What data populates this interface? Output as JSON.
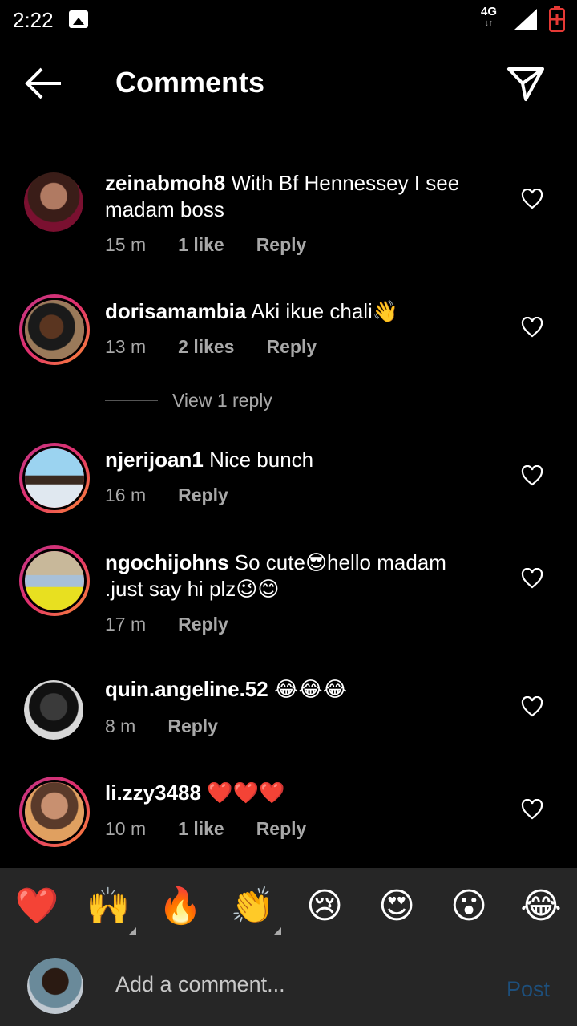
{
  "status_bar": {
    "time": "2:22",
    "network": "4G"
  },
  "header": {
    "title": "Comments"
  },
  "comments": [
    {
      "username": "zeinabmoh8",
      "text": "With Bf Hennessey I see madam boss",
      "time": "15 m",
      "likes": "1 like",
      "reply": "Reply"
    },
    {
      "username": "dorisamambia",
      "text": "Aki ikue chali👋",
      "time": "13 m",
      "likes": "2 likes",
      "reply": "Reply",
      "view_replies": "View 1 reply"
    },
    {
      "username": "njerijoan1",
      "text": "Nice bunch",
      "time": "16 m",
      "reply": "Reply"
    },
    {
      "username": "ngochijohns",
      "text": "So cute😎hello madam .just say hi plz😉😊",
      "time": "17 m",
      "reply": "Reply"
    },
    {
      "username": "quin.angeline.52",
      "text": "😂😂😂",
      "time": "8 m",
      "reply": "Reply"
    },
    {
      "username": "li.zzy3488",
      "text": "❤️❤️❤️",
      "time": "10 m",
      "likes": "1 like",
      "reply": "Reply"
    }
  ],
  "emoji_bar": [
    "❤️",
    "🙌",
    "🔥",
    "👏",
    "😢",
    "😍",
    "😮",
    "😂"
  ],
  "input": {
    "placeholder": "Add a comment...",
    "post_label": "Post"
  },
  "colors": {
    "background": "#000000",
    "panel": "#262626",
    "meta_text": "#a8a8a8",
    "post_disabled": "#1d4f7c"
  }
}
